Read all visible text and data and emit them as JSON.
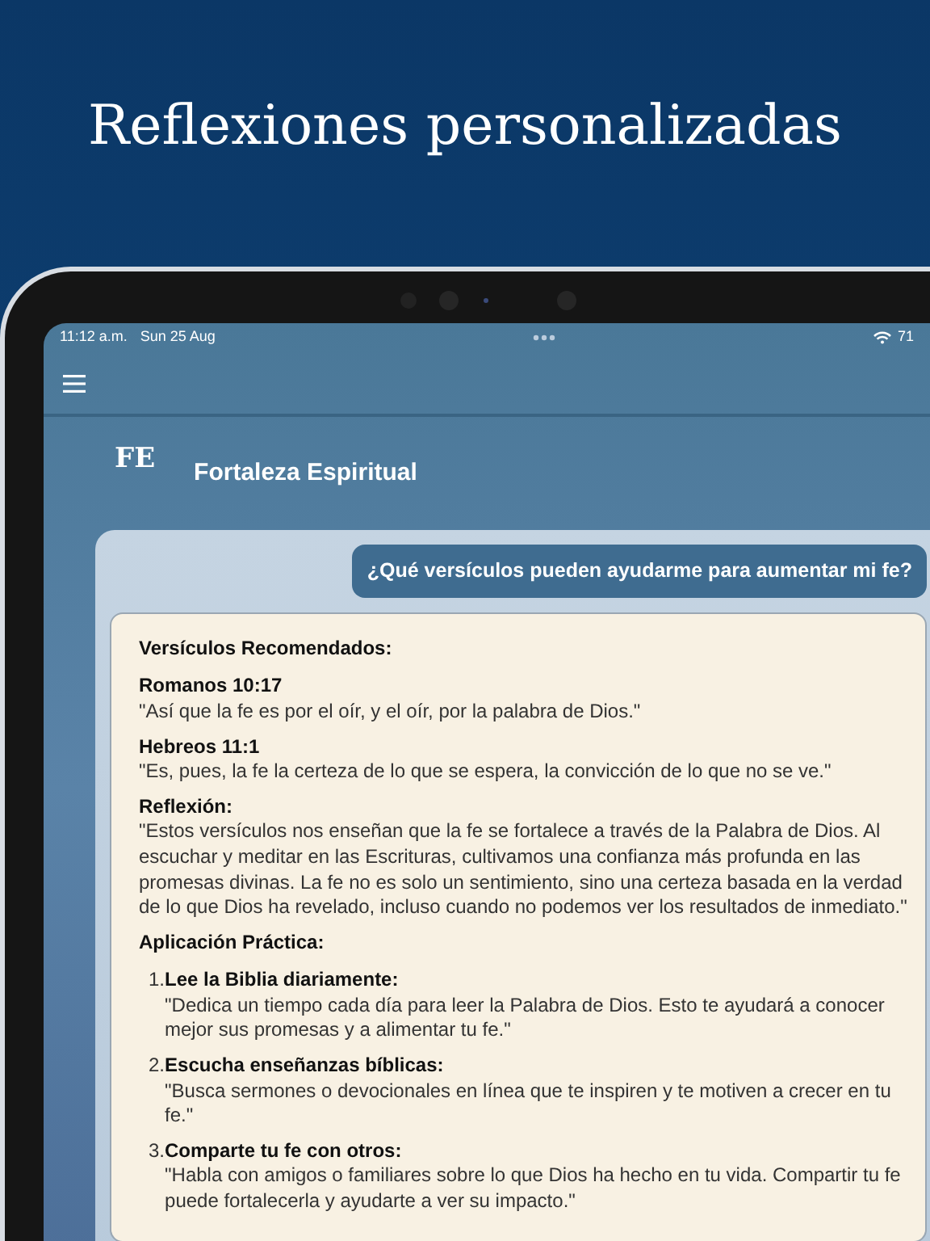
{
  "headline": "Reflexiones personalizadas",
  "status_bar": {
    "time": "11:12 a.m.",
    "date": "Sun 25 Aug",
    "battery": "71"
  },
  "app": {
    "logo": "FE",
    "title": "Fortaleza Espiritual"
  },
  "chat": {
    "question": "¿Qué versículos pueden ayudarme para aumentar mi fe?",
    "answer": [
      {
        "kind": "heading",
        "text": "Versículos Recomendados:"
      },
      {
        "kind": "entry",
        "title": "Romanos 10:17",
        "text": "\"Así que la fe es por el oír, y el oír, por la palabra de Dios.\""
      },
      {
        "kind": "entry",
        "title": "Hebreos 11:1",
        "text": "\"Es, pues, la fe la certeza de lo que se espera, la convicción de lo que no se ve.\""
      },
      {
        "kind": "entry",
        "title": "Reflexión:",
        "text": "\"Estos versículos nos enseñan que la fe se fortalece a través de la Palabra de Dios. Al escuchar y meditar en las Escrituras, cultivamos una confianza más profunda en las promesas divinas. La fe no es solo un sentimiento, sino una certeza basada en la verdad de lo que Dios ha revelado, incluso cuando no podemos ver los resultados de inmediato.\""
      },
      {
        "kind": "heading",
        "text": "Aplicación Práctica:"
      },
      {
        "kind": "step",
        "number": "1.",
        "title": "Lee la Biblia diariamente:",
        "text": "\"Dedica un tiempo cada día para leer la Palabra de Dios. Esto te ayudará a conocer mejor sus promesas y a alimentar tu fe.\""
      },
      {
        "kind": "step",
        "number": "2.",
        "title": "Escucha enseñanzas bíblicas:",
        "text": "\"Busca sermones o devocionales en línea que te inspiren y te motiven a crecer en tu fe.\""
      },
      {
        "kind": "step",
        "number": "3.",
        "title": "Comparte tu fe con otros:",
        "text": "\"Habla con amigos o familiares sobre lo que Dios ha hecho en tu vida. Compartir tu fe puede fortalecerla y ayudarte a ver su impacto.\""
      }
    ]
  }
}
